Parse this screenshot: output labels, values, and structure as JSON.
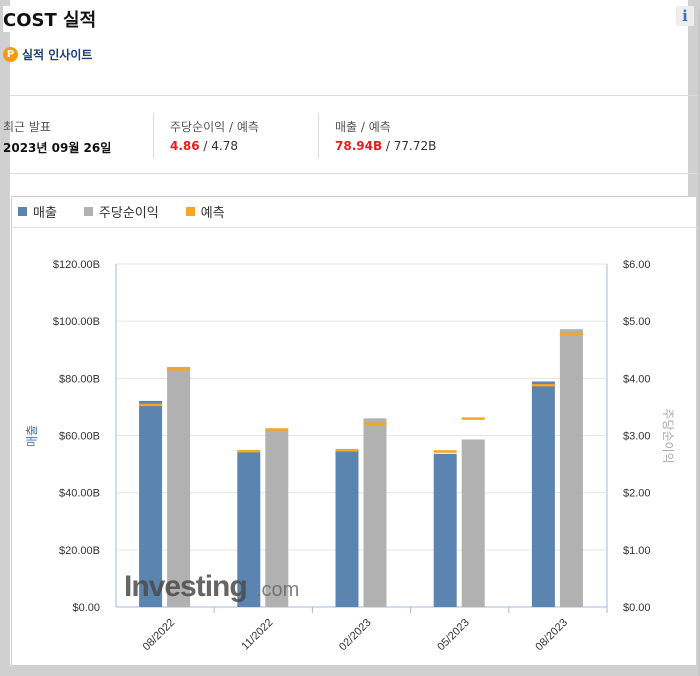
{
  "header": {
    "title": "COST 실적",
    "insight_label": "실적 인사이트",
    "insight_icon": "p-icon",
    "info_icon": "info-icon"
  },
  "stats": {
    "recent": {
      "label": "최근 발표",
      "value": "2023년 09월 26일"
    },
    "eps": {
      "label": "주당순이익 / 예측",
      "actual": "4.86",
      "forecast": " / 4.78"
    },
    "revenue": {
      "label": "매출 / 예측",
      "actual": "78.94B",
      "forecast": " / 77.72B"
    }
  },
  "legend": [
    {
      "label": "매출",
      "color": "#5b84b1"
    },
    {
      "label": "주당순이익",
      "color": "#b1b1b1"
    },
    {
      "label": "예측",
      "color": "#f5a623"
    }
  ],
  "watermark": {
    "main": "Investing",
    "suffix": ".com"
  },
  "chart_data": {
    "type": "bar",
    "categories": [
      "08/2022",
      "11/2022",
      "02/2023",
      "05/2023",
      "08/2023"
    ],
    "left_axis": {
      "label": "매출",
      "ylim": [
        0,
        120
      ],
      "ticks": [
        "$0.00",
        "$20.00B",
        "$40.00B",
        "$60.00B",
        "$80.00B",
        "$100.00B",
        "$120.00B"
      ]
    },
    "right_axis": {
      "label": "주당순이익",
      "ylim": [
        0,
        6
      ],
      "ticks": [
        "$0.00",
        "$1.00",
        "$2.00",
        "$3.00",
        "$4.00",
        "$5.00",
        "$6.00"
      ]
    },
    "series": [
      {
        "name": "매출",
        "axis": "left",
        "values": [
          72.1,
          54.4,
          55.3,
          53.6,
          78.9
        ],
        "forecast": [
          70.8,
          54.6,
          54.9,
          54.5,
          77.7
        ]
      },
      {
        "name": "주당순이익",
        "axis": "right",
        "values": [
          4.2,
          3.1,
          3.3,
          2.93,
          4.86
        ],
        "forecast": [
          4.16,
          3.11,
          3.21,
          3.3,
          4.78
        ]
      }
    ],
    "grid": true
  }
}
